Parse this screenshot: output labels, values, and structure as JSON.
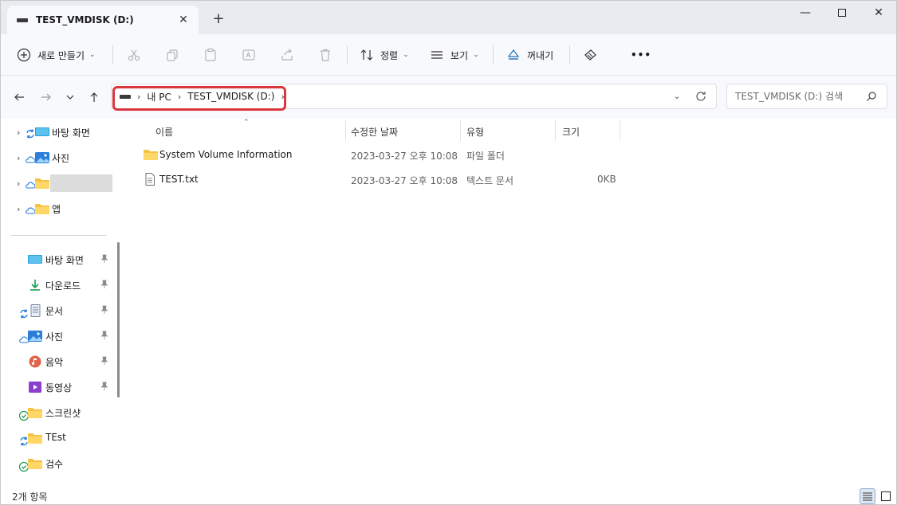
{
  "tab": {
    "title": "TEST_VMDISK (D:)",
    "close": "✕",
    "new": "+"
  },
  "window_controls": {
    "minimize": "—",
    "close": "✕"
  },
  "toolbar": {
    "new_label": "새로 만들기",
    "sort_label": "정렬",
    "view_label": "보기",
    "eject_label": "꺼내기",
    "more_label": "•••"
  },
  "address": {
    "crumbs": [
      "내 PC",
      "TEST_VMDISK (D:)"
    ],
    "search_placeholder": "TEST_VMDISK (D:) 검색"
  },
  "nav": {
    "top_items": [
      {
        "label": "바탕 화면",
        "icon": "desktop-icon",
        "status": "sync"
      },
      {
        "label": "사진",
        "icon": "pictures-icon",
        "status": "cloud"
      },
      {
        "label": "",
        "icon": "folder-icon",
        "status": "cloud"
      },
      {
        "label": "앱",
        "icon": "folder-icon",
        "status": "cloud"
      }
    ],
    "quick_items": [
      {
        "label": "바탕 화면",
        "icon": "desktop-icon",
        "status": "",
        "pinned": true
      },
      {
        "label": "다운로드",
        "icon": "download-icon",
        "status": "",
        "pinned": true
      },
      {
        "label": "문서",
        "icon": "document-icon",
        "status": "sync",
        "pinned": true
      },
      {
        "label": "사진",
        "icon": "pictures-icon",
        "status": "cloud",
        "pinned": true
      },
      {
        "label": "음악",
        "icon": "music-icon",
        "status": "",
        "pinned": true
      },
      {
        "label": "동영상",
        "icon": "video-icon",
        "status": "",
        "pinned": true
      },
      {
        "label": "스크린샷",
        "icon": "folder-icon",
        "status": "check",
        "pinned": false
      },
      {
        "label": "TEst",
        "icon": "folder-icon",
        "status": "sync",
        "pinned": false
      },
      {
        "label": "검수",
        "icon": "folder-icon",
        "status": "check",
        "pinned": false
      }
    ]
  },
  "columns": {
    "name": "이름",
    "date": "수정한 날짜",
    "type": "유형",
    "size": "크기"
  },
  "files": [
    {
      "name": "System Volume Information",
      "date": "2023-03-27 오후 10:08",
      "type": "파일 폴더",
      "size": "",
      "icon": "folder-icon"
    },
    {
      "name": "TEST.txt",
      "date": "2023-03-27 오후 10:08",
      "type": "텍스트 문서",
      "size": "0KB",
      "icon": "text-file-icon"
    }
  ],
  "status": {
    "count": "2개 항목"
  },
  "colors": {
    "accent_red": "#d9363e",
    "folder": "#f5c242",
    "toolbar_bg": "#f7f9fc"
  }
}
